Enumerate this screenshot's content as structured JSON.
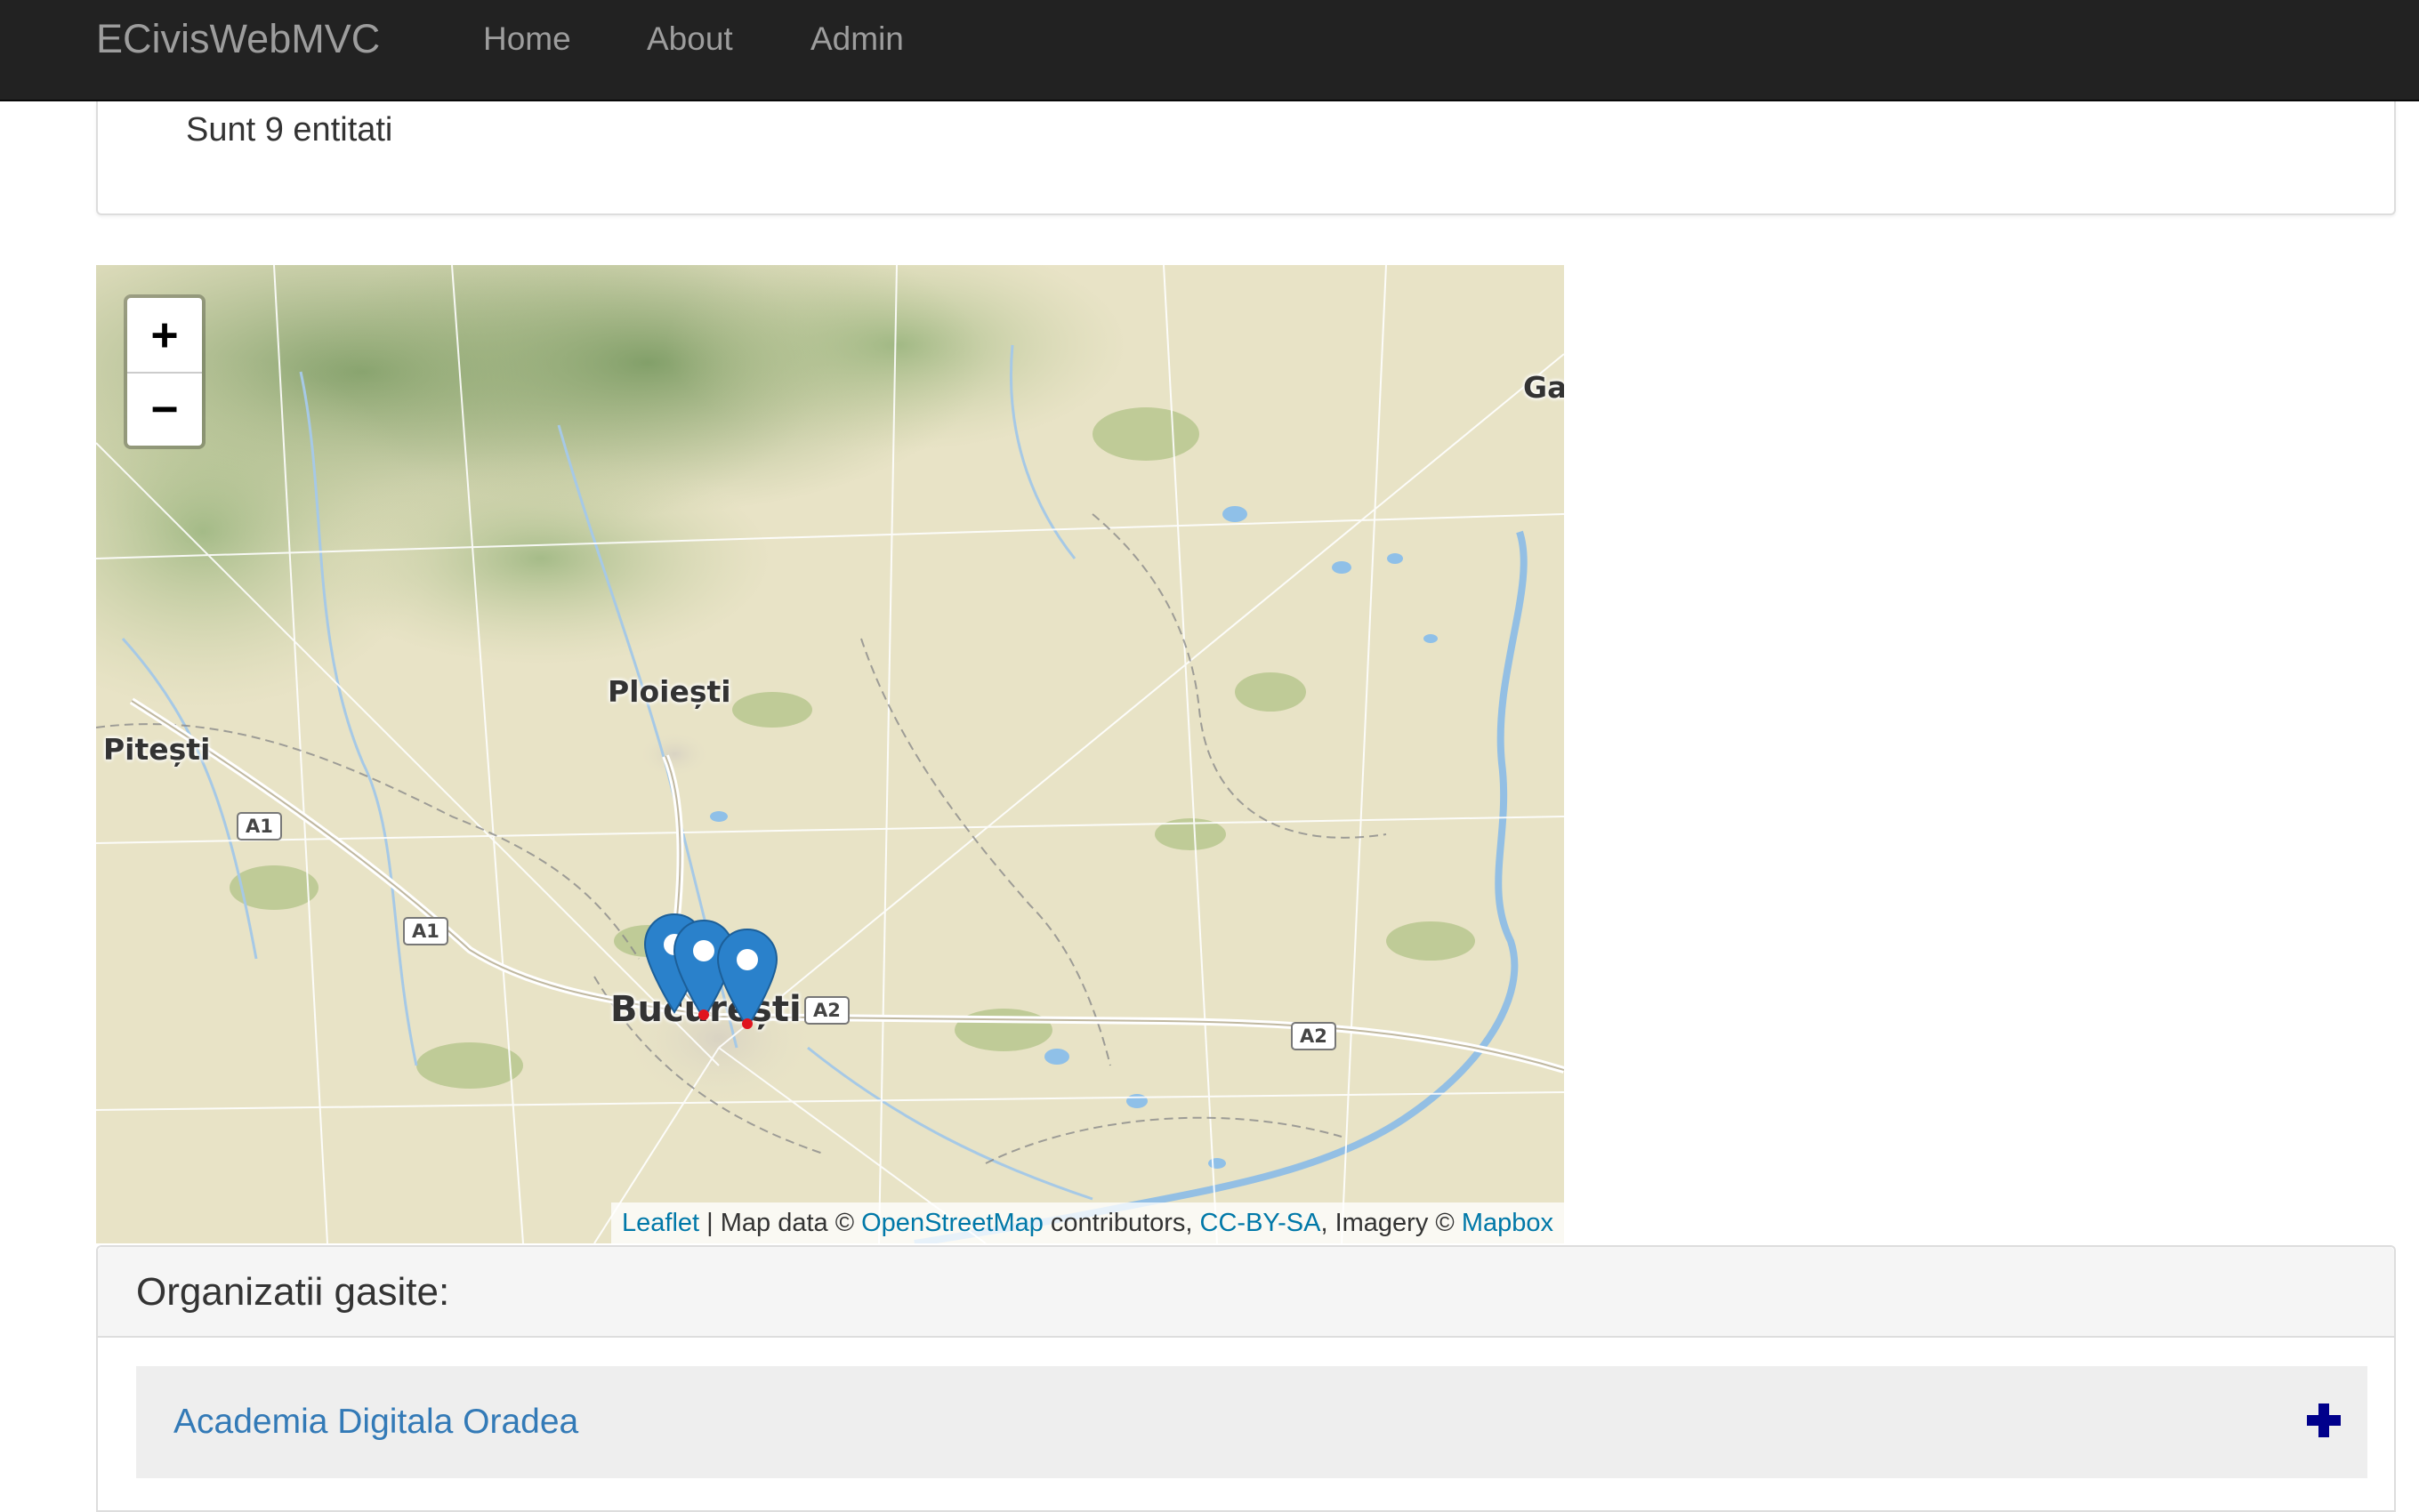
{
  "navbar": {
    "brand": "ECivisWebMVC",
    "links": [
      {
        "label": "Home"
      },
      {
        "label": "About"
      },
      {
        "label": "Admin"
      }
    ]
  },
  "info": {
    "entity_count_text": "Sunt 9 entitati"
  },
  "map": {
    "zoom_in_label": "+",
    "zoom_out_label": "−",
    "place_labels": [
      "Ploiești",
      "Pitești",
      "București",
      "Ga"
    ],
    "road_shields": [
      "A1",
      "A1",
      "A2",
      "A2"
    ],
    "marker_count_visible": 3,
    "attribution": {
      "leaflet": "Leaflet",
      "sep1": " | Map data © ",
      "osm": "OpenStreetMap",
      "sep2": " contributors, ",
      "license": "CC-BY-SA",
      "sep3": ", Imagery © ",
      "imagery": "Mapbox"
    }
  },
  "results": {
    "title": "Organizatii gasite:",
    "items": [
      {
        "name": "Academia Digitala Oradea",
        "expand_icon": "plus-icon"
      }
    ]
  },
  "colors": {
    "navbar_bg": "#222222",
    "navbar_text": "#9d9d9d",
    "link": "#337ab7",
    "attribution_link": "#0078a8",
    "marker": "#2a81cb",
    "expand_icon": "#00008b"
  }
}
